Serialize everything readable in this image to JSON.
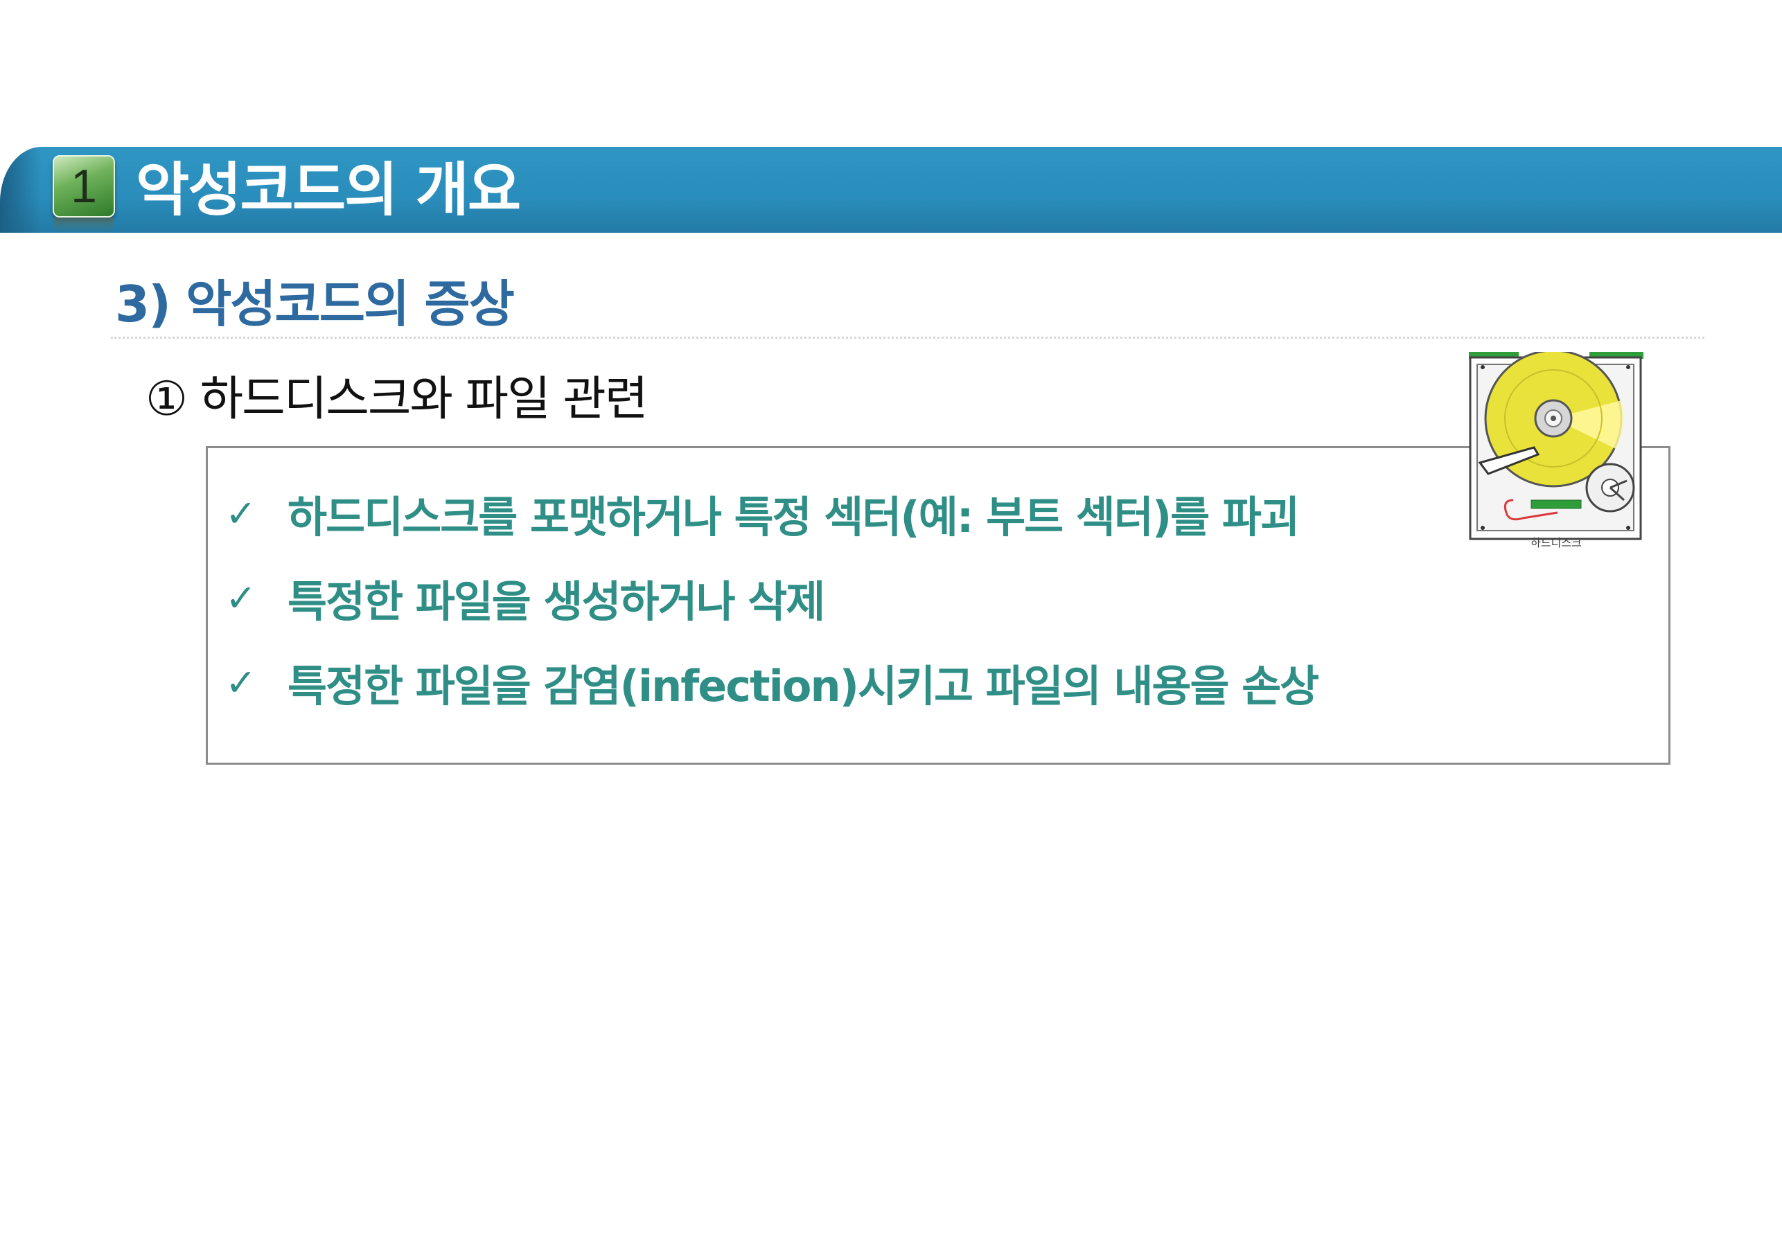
{
  "header": {
    "number": "1",
    "title": "악성코드의 개요"
  },
  "section": {
    "title": "3) 악성코드의 증상",
    "subtitle": "① 하드디스크와 파일 관련"
  },
  "bullets": [
    {
      "check": "✓",
      "text": "하드디스크를 포맷하거나 특정 섹터(예: 부트 섹터)를 파괴"
    },
    {
      "check": "✓",
      "text": "특정한 파일을 생성하거나 삭제"
    },
    {
      "check": "✓",
      "text": "특정한 파일을 감염(infection)시키고 파일의 내용을 손상"
    }
  ],
  "image": {
    "caption": "하드디스크"
  },
  "colors": {
    "banner": "#2a8dbb",
    "section_title": "#2e6aa0",
    "bullet_text": "#2f8e86",
    "box_border": "#8c8c8c"
  }
}
